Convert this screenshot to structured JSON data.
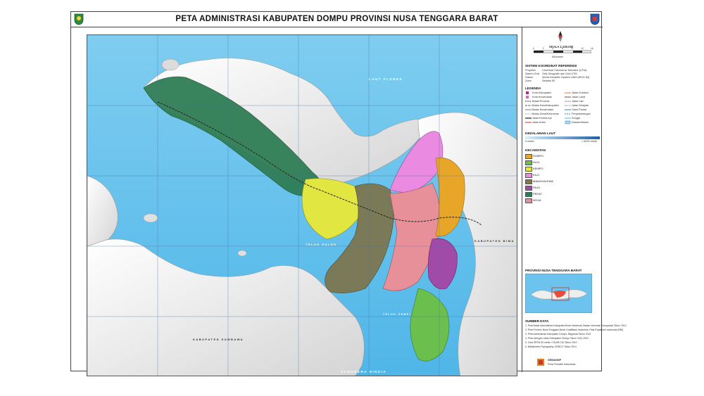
{
  "title": "PETA ADMINISTRASI KABUPATEN DOMPU PROVINSI NUSA TENGGARA BARAT",
  "scale": {
    "label": "SKALA 1:100.000",
    "ticks": [
      "0",
      "2",
      "4",
      "6",
      "8",
      "12",
      "16"
    ],
    "unit": "Kilometer"
  },
  "sections": {
    "coord": "SISTEM KOORDINAT REFERENSI",
    "legenda": "LEGENDA",
    "kedalaman": "KEDALAMAN LAUT",
    "kecamatan": "KECAMATAN",
    "inset": "PROVINSI NUSA TENGGARA BARAT",
    "sumber": "SUMBER DATA"
  },
  "coord_rows": [
    [
      "Proyeksi",
      "Universal Transverse Mercator (UTM)"
    ],
    [
      "Sistem Grid",
      "Grid Geografis dan Grid UTM"
    ],
    [
      "Datum",
      "World Geodetic System 1984 (WGS 84)"
    ],
    [
      "Zona",
      "Selatan 50"
    ]
  ],
  "legend_left": [
    "Kota Kabupaten",
    "Kota Kecamatan",
    "Batas Provinsi",
    "Batas Kota/Kabupaten",
    "Batas Kecamatan",
    "Batas Desa/Kelurahan",
    "Jalan Kereta Api",
    "Jalan Arteri"
  ],
  "legend_right": [
    "Jalan Kolektor",
    "Jalan Lokal",
    "Jalan Lain",
    "Jalan Setapak",
    "Garis Pantai",
    "Penyeberangan",
    "Sungai",
    "Danau/Waduk"
  ],
  "depth": {
    "min": "0 meter",
    "max": "> 6000 meter"
  },
  "kecamatan": [
    {
      "name": "DOMPU",
      "color": "#e8a628"
    },
    {
      "name": "HU'U",
      "color": "#6bbf4c"
    },
    {
      "name": "KEMPO",
      "color": "#e2e640"
    },
    {
      "name": "KILO",
      "color": "#ea8ae0"
    },
    {
      "name": "MANGGALEWA",
      "color": "#7b7a58"
    },
    {
      "name": "PAJO",
      "color": "#a24aa8"
    },
    {
      "name": "PEKAT",
      "color": "#2f7d55"
    },
    {
      "name": "WOJA",
      "color": "#e8909a"
    }
  ],
  "map_labels": {
    "laut_flores": "LAUT FLORES",
    "teluk_saleh": "TELUK SALEH",
    "samudera": "SAMUDERA HINDIA",
    "sumbawa": "KABUPATEN SUMBAWA",
    "bima": "KABUPATEN BIMA",
    "teluk_cempi": "TELUK CEMPI"
  },
  "sumber_items": [
    "1. Peta Batas Administrasi Kabupaten/Kota Indonesia, Badan Informasi Geospasial Tahun 2013",
    "2. Peta Provinsi Nusa Tenggara Barat, Kualifikasi Indonesia, Peta Rupabumi Indonesia (RBI)",
    "3. Peta Administrasi Kabupaten Dompu, Bappeda Tahun 2013",
    "4. Peta Jaringan Jalan Kabupaten Dompu Tahun 2011-2031",
    "5. Citra SRTM 30 meter, CGIAR-CSI Tahun 2010",
    "6. Bathymetric Topography, GEBCO Tahun 2014"
  ],
  "footer": {
    "l1": "DEMANNP",
    "l2": "Peta Tematik Indonesia"
  },
  "colors": {
    "sea": "#6cc4ee",
    "land": "#f0f0f0",
    "grid": "#4a6fa5"
  }
}
